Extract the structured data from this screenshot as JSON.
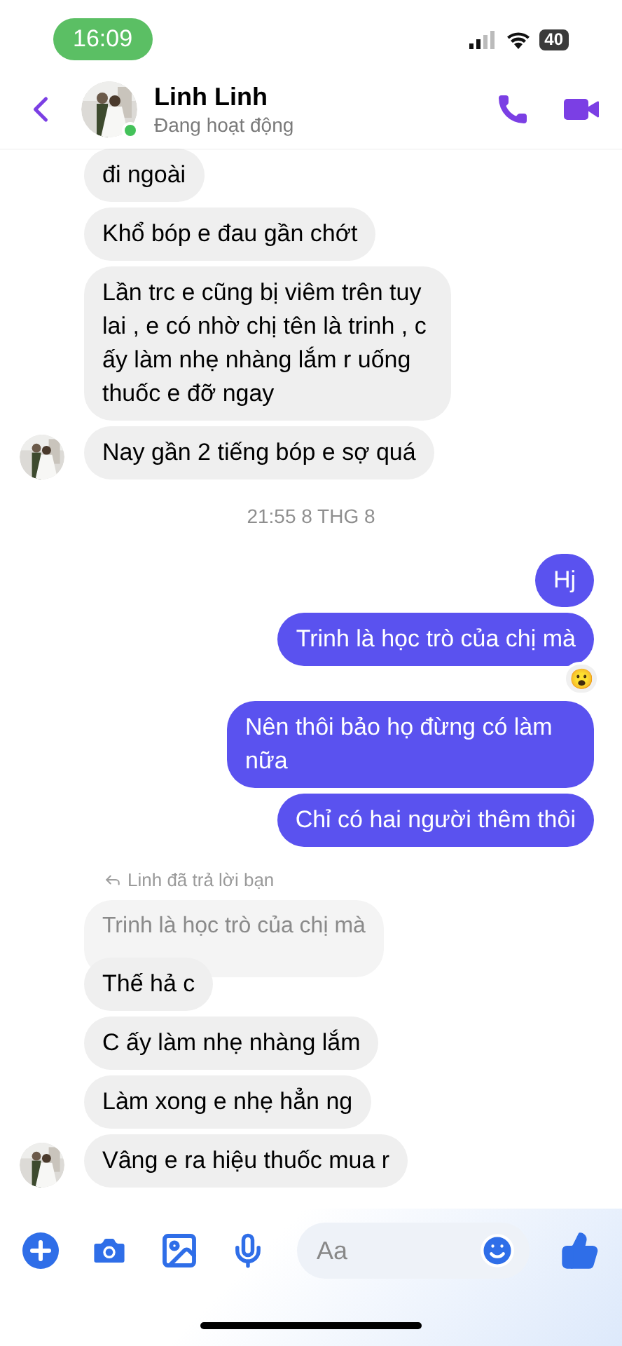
{
  "status_bar": {
    "time": "16:09",
    "battery": "40"
  },
  "header": {
    "name": "Linh Linh",
    "status": "Đang hoạt động",
    "online": true
  },
  "messages": [
    {
      "kind": "incoming",
      "text": "đi ngoài",
      "avatar": false
    },
    {
      "kind": "incoming",
      "text": "Khổ bóp e đau gần chớt",
      "avatar": false
    },
    {
      "kind": "incoming",
      "text": "Lần trc e cũng bị viêm trên tuy lai , e có nhờ chị tên là trinh , c ấy làm nhẹ nhàng lắm r uống thuốc e đỡ ngay",
      "avatar": false
    },
    {
      "kind": "incoming",
      "text": "Nay gần 2 tiếng bóp e sợ quá",
      "avatar": true
    },
    {
      "kind": "timestamp",
      "text": "21:55 8 THG 8"
    },
    {
      "kind": "outgoing",
      "text": "Hj"
    },
    {
      "kind": "outgoing",
      "text": "Trinh là học trò của chị mà",
      "reaction": "😮"
    },
    {
      "kind": "outgoing",
      "text": "Nên thôi bảo họ đừng có làm nữa"
    },
    {
      "kind": "outgoing",
      "text": "Chỉ có hai người thêm thôi"
    },
    {
      "kind": "reply_note",
      "text": "Linh đã trả lời bạn"
    },
    {
      "kind": "quoted",
      "text": "Trinh là học trò của chị mà"
    },
    {
      "kind": "incoming",
      "text": "Thế hả c",
      "avatar": false
    },
    {
      "kind": "incoming",
      "text": "C ấy làm nhẹ nhàng lắm",
      "avatar": false
    },
    {
      "kind": "incoming",
      "text": "Làm xong e nhẹ hẳn ng",
      "avatar": false
    },
    {
      "kind": "incoming",
      "text": "Vâng e ra hiệu thuốc mua r",
      "avatar": true
    }
  ],
  "composer": {
    "placeholder": "Aa"
  }
}
